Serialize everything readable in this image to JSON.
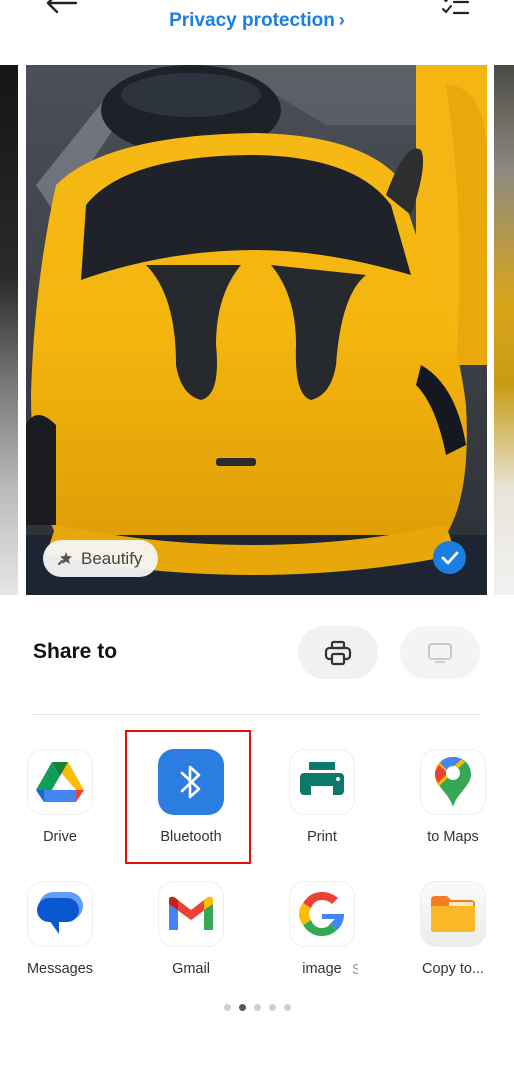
{
  "header": {
    "back_icon": "arrow-left-icon",
    "privacy_link": "Privacy protection",
    "privacy_chevron": "›",
    "select_icon": "checklist-icon"
  },
  "photo": {
    "beautify_label": "Beautify",
    "selected": true,
    "accent": "#1a7fe0"
  },
  "share": {
    "title": "Share to",
    "print_icon": "printer-outline-icon",
    "cast_icon": "monitor-icon",
    "apps": [
      {
        "label": "Drive",
        "icon": "google-drive-icon"
      },
      {
        "label": "Bluetooth",
        "icon": "bluetooth-icon"
      },
      {
        "label": "Print",
        "icon": "printer-icon"
      },
      {
        "label": "to Maps",
        "icon": "google-maps-icon"
      },
      {
        "label": "Messages",
        "icon": "messages-icon"
      },
      {
        "label": "Gmail",
        "icon": "gmail-icon"
      },
      {
        "label": "image",
        "icon": "google-icon"
      },
      {
        "label": "Copy to...",
        "icon": "folder-icon"
      }
    ],
    "truncated_char": "S",
    "highlight_color": "#e01010"
  },
  "pagination": {
    "total": 5,
    "active_index": 1
  }
}
